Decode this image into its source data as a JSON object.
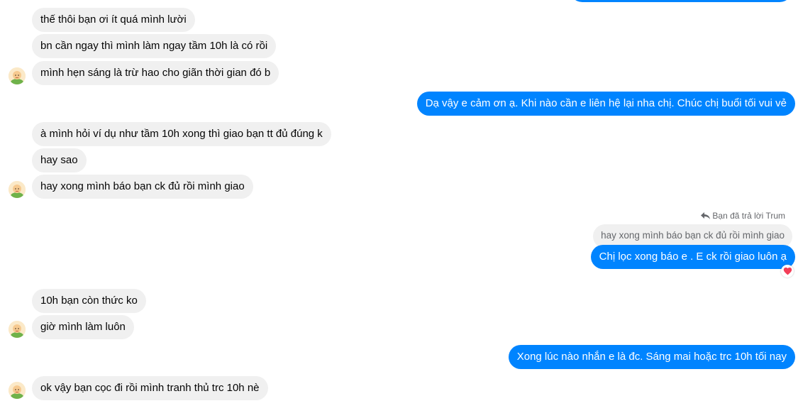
{
  "messages": {
    "m1": "thế thôi bạn ơi ít quá mình lười",
    "m2": "bn cần ngay thì mình làm ngay tầm 10h là có rồi",
    "m3": "mình hẹn sáng là trừ hao cho giãn thời gian đó b",
    "m4": "Dạ vậy e cảm ơn ạ. Khi nào cần e liên hệ lại nha chị. Chúc chị buổi tối vui vẻ",
    "m5": "à mình hỏi ví dụ như tầm 10h xong thì giao bạn tt đủ đúng k",
    "m6": "hay sao",
    "m7": "hay xong mình báo bạn ck đủ rồi mình giao",
    "m8": "Chị lọc xong báo e . E ck rồi giao luôn ạ",
    "m9": "10h bạn còn thức ko",
    "m10": "giờ mình làm luôn",
    "m11": "Xong lúc nào nhắn e là đc. Sáng mai hoặc trc 10h tối nay",
    "m12": "ok vậy bạn cọc đi rồi mình tranh thủ trc 10h nè"
  },
  "reply": {
    "label": "Bạn đã trả lời Trum",
    "quoted_text": "hay xong mình báo bạn ck đủ rồi mình giao"
  },
  "icons": {
    "reply": "reply-arrow-icon",
    "reaction": "heart-icon",
    "avatar": "contact-avatar"
  },
  "colors": {
    "outgoing_bubble": "#0084ff",
    "incoming_bubble": "#f0f0f0",
    "reaction_heart": "#f33e58"
  }
}
